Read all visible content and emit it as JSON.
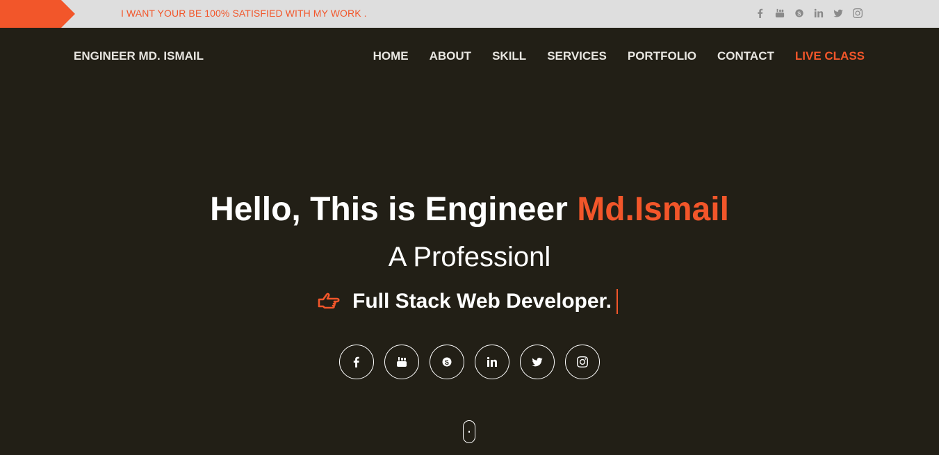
{
  "topbar": {
    "message": "I WANT YOUR BE 100% SATISFIED WITH MY WORK .",
    "social_icons": [
      "facebook-icon",
      "youtube-icon",
      "skype-icon",
      "linkedin-icon",
      "twitter-icon",
      "instagram-icon"
    ]
  },
  "header": {
    "brand": "ENGINEER MD. ISMAIL",
    "nav": [
      "HOME",
      "ABOUT",
      "SKILL",
      "SERVICES",
      "PORTFOLIO",
      "CONTACT",
      "LIVE CLASS"
    ]
  },
  "hero": {
    "title_prefix": "Hello, This is Engineer ",
    "title_highlight": "Md.Ismail",
    "subtitle": "A Professionl",
    "role": "Full Stack Web Developer.",
    "social_icons": [
      "facebook-icon",
      "youtube-icon",
      "skype-icon",
      "linkedin-icon",
      "twitter-icon",
      "instagram-icon"
    ]
  },
  "colors": {
    "accent": "#f2562a",
    "background": "#221f16",
    "topbar": "#dedede"
  }
}
